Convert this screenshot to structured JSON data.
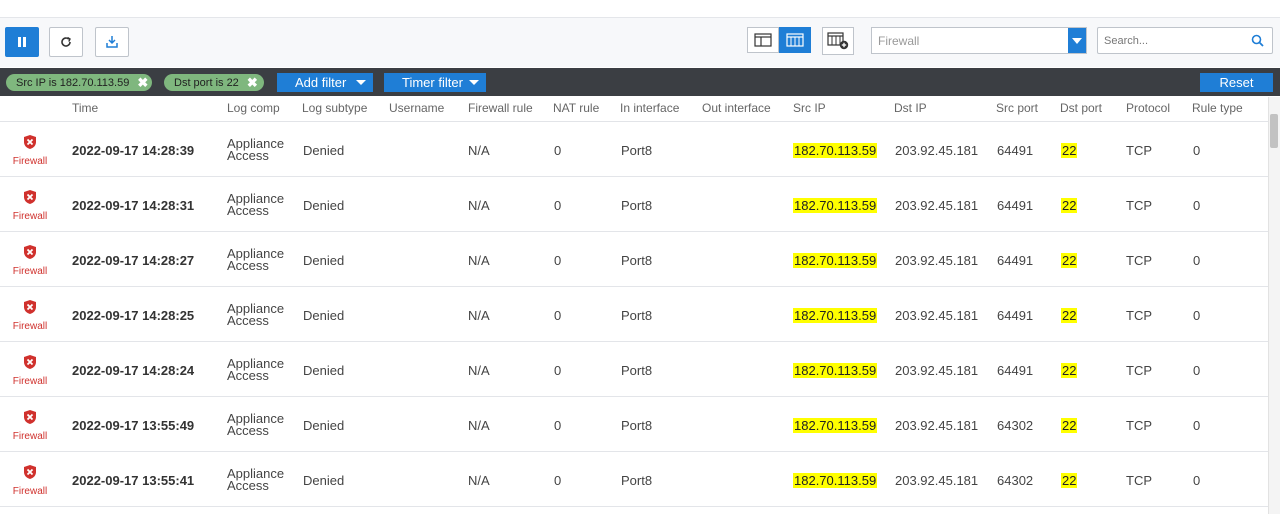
{
  "toolbar": {
    "pause_icon": "pause-icon",
    "refresh_icon": "refresh-icon",
    "export_icon": "export-icon",
    "views": [
      "detail-view-icon",
      "grid-view-icon",
      "add-column-icon"
    ],
    "log_type": "Firewall",
    "search_placeholder": "Search..."
  },
  "filters": {
    "chips": [
      {
        "label": "Src IP is 182.70.113.59"
      },
      {
        "label": "Dst port is 22"
      }
    ],
    "add_filter": "Add filter",
    "timer_filter": "Timer filter",
    "reset": "Reset"
  },
  "columns": [
    "Time",
    "Log comp",
    "Log subtype",
    "Username",
    "Firewall rule",
    "NAT rule",
    "In interface",
    "Out interface",
    "Src IP",
    "Dst IP",
    "Src port",
    "Dst port",
    "Protocol",
    "Rule type"
  ],
  "rows": [
    {
      "module": "Firewall",
      "time": "2022-09-17 14:28:39",
      "comp1": "Appliance",
      "comp2": "Access",
      "subtype": "Denied",
      "fw_rule": "N/A",
      "nat_rule": "0",
      "in_if": "Port8",
      "src_ip": "182.70.113.59",
      "dst_ip": "203.92.45.181",
      "src_port": "64491",
      "dst_port": "22",
      "protocol": "TCP",
      "rule_type": "0"
    },
    {
      "module": "Firewall",
      "time": "2022-09-17 14:28:31",
      "comp1": "Appliance",
      "comp2": "Access",
      "subtype": "Denied",
      "fw_rule": "N/A",
      "nat_rule": "0",
      "in_if": "Port8",
      "src_ip": "182.70.113.59",
      "dst_ip": "203.92.45.181",
      "src_port": "64491",
      "dst_port": "22",
      "protocol": "TCP",
      "rule_type": "0"
    },
    {
      "module": "Firewall",
      "time": "2022-09-17 14:28:27",
      "comp1": "Appliance",
      "comp2": "Access",
      "subtype": "Denied",
      "fw_rule": "N/A",
      "nat_rule": "0",
      "in_if": "Port8",
      "src_ip": "182.70.113.59",
      "dst_ip": "203.92.45.181",
      "src_port": "64491",
      "dst_port": "22",
      "protocol": "TCP",
      "rule_type": "0"
    },
    {
      "module": "Firewall",
      "time": "2022-09-17 14:28:25",
      "comp1": "Appliance",
      "comp2": "Access",
      "subtype": "Denied",
      "fw_rule": "N/A",
      "nat_rule": "0",
      "in_if": "Port8",
      "src_ip": "182.70.113.59",
      "dst_ip": "203.92.45.181",
      "src_port": "64491",
      "dst_port": "22",
      "protocol": "TCP",
      "rule_type": "0"
    },
    {
      "module": "Firewall",
      "time": "2022-09-17 14:28:24",
      "comp1": "Appliance",
      "comp2": "Access",
      "subtype": "Denied",
      "fw_rule": "N/A",
      "nat_rule": "0",
      "in_if": "Port8",
      "src_ip": "182.70.113.59",
      "dst_ip": "203.92.45.181",
      "src_port": "64491",
      "dst_port": "22",
      "protocol": "TCP",
      "rule_type": "0"
    },
    {
      "module": "Firewall",
      "time": "2022-09-17 13:55:49",
      "comp1": "Appliance",
      "comp2": "Access",
      "subtype": "Denied",
      "fw_rule": "N/A",
      "nat_rule": "0",
      "in_if": "Port8",
      "src_ip": "182.70.113.59",
      "dst_ip": "203.92.45.181",
      "src_port": "64302",
      "dst_port": "22",
      "protocol": "TCP",
      "rule_type": "0"
    },
    {
      "module": "Firewall",
      "time": "2022-09-17 13:55:41",
      "comp1": "Appliance",
      "comp2": "Access",
      "subtype": "Denied",
      "fw_rule": "N/A",
      "nat_rule": "0",
      "in_if": "Port8",
      "src_ip": "182.70.113.59",
      "dst_ip": "203.92.45.181",
      "src_port": "64302",
      "dst_port": "22",
      "protocol": "TCP",
      "rule_type": "0"
    }
  ],
  "colors": {
    "accent": "#1f7ed6",
    "highlight": "#ffff00",
    "filter_bar": "#3b3e43",
    "chip": "#7fb77e",
    "firewall_red": "#d0312d"
  }
}
